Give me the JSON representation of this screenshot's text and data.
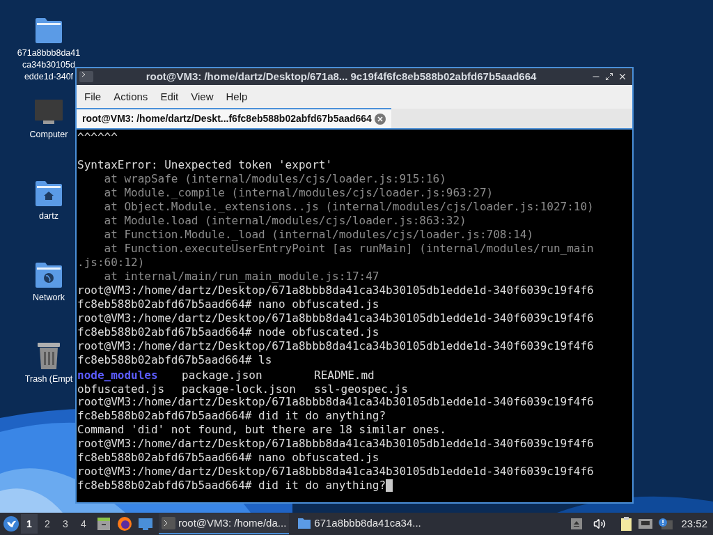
{
  "desktop_icons": [
    {
      "kind": "folder",
      "label_lines": [
        "671a8bbb8da41",
        "ca34b30105d",
        "edde1d-340f"
      ]
    },
    {
      "kind": "computer",
      "label_lines": [
        "Computer"
      ]
    },
    {
      "kind": "home",
      "label_lines": [
        "dartz"
      ]
    },
    {
      "kind": "network",
      "label_lines": [
        "Network"
      ]
    },
    {
      "kind": "trash",
      "label_lines": [
        "Trash (Empt"
      ]
    }
  ],
  "window": {
    "title": "root@VM3: /home/dartz/Desktop/671a8... 9c19f4f6fc8eb588b02abfd67b5aad664",
    "menu": [
      "File",
      "Actions",
      "Edit",
      "View",
      "Help"
    ],
    "tabs": [
      {
        "label": "root@VM3: /home/dartz/Deskt...f6fc8eb588b02abfd67b5aad664",
        "selected": true
      }
    ],
    "lines": [
      {
        "kind": "output",
        "text": "^^^^^^"
      },
      {
        "kind": "blank"
      },
      {
        "kind": "output",
        "text": "SyntaxError: Unexpected token 'export'"
      },
      {
        "kind": "trace",
        "text": "    at wrapSafe (internal/modules/cjs/loader.js:915:16)"
      },
      {
        "kind": "trace",
        "text": "    at Module._compile (internal/modules/cjs/loader.js:963:27)"
      },
      {
        "kind": "trace",
        "text": "    at Object.Module._extensions..js (internal/modules/cjs/loader.js:1027:10)"
      },
      {
        "kind": "trace",
        "text": "    at Module.load (internal/modules/cjs/loader.js:863:32)"
      },
      {
        "kind": "trace",
        "text": "    at Function.Module._load (internal/modules/cjs/loader.js:708:14)"
      },
      {
        "kind": "trace",
        "text": "    at Function.executeUserEntryPoint [as runMain] (internal/modules/run_main"
      },
      {
        "kind": "trace",
        "text": ".js:60:12)"
      },
      {
        "kind": "trace",
        "text": "    at internal/main/run_main_module.js:17:47"
      },
      {
        "kind": "output",
        "text": "root@VM3:/home/dartz/Desktop/671a8bbb8da41ca34b30105db1edde1d-340f6039c19f4f6"
      },
      {
        "kind": "output",
        "text": "fc8eb588b02abfd67b5aad664# nano obfuscated.js"
      },
      {
        "kind": "output",
        "text": "root@VM3:/home/dartz/Desktop/671a8bbb8da41ca34b30105db1edde1d-340f6039c19f4f6"
      },
      {
        "kind": "output",
        "text": "fc8eb588b02abfd67b5aad664# node obfuscated.js"
      },
      {
        "kind": "output",
        "text": "root@VM3:/home/dartz/Desktop/671a8bbb8da41ca34b30105db1edde1d-340f6039c19f4f6"
      },
      {
        "kind": "output",
        "text": "fc8eb588b02abfd67b5aad664# ls"
      },
      {
        "kind": "listing",
        "entries": [
          {
            "text": "node_modules",
            "directory": true
          },
          {
            "text": "package.json",
            "directory": false
          },
          {
            "text": "README.md",
            "directory": false
          }
        ]
      },
      {
        "kind": "listing",
        "entries": [
          {
            "text": "obfuscated.js",
            "directory": false
          },
          {
            "text": "package-lock.json",
            "directory": false
          },
          {
            "text": "ssl-geospec.js",
            "directory": false
          }
        ]
      },
      {
        "kind": "output",
        "text": "root@VM3:/home/dartz/Desktop/671a8bbb8da41ca34b30105db1edde1d-340f6039c19f4f6"
      },
      {
        "kind": "output",
        "text": "fc8eb588b02abfd67b5aad664# did it do anything?"
      },
      {
        "kind": "output",
        "text": "Command 'did' not found, but there are 18 similar ones."
      },
      {
        "kind": "output",
        "text": "root@VM3:/home/dartz/Desktop/671a8bbb8da41ca34b30105db1edde1d-340f6039c19f4f6"
      },
      {
        "kind": "output",
        "text": "fc8eb588b02abfd67b5aad664# nano obfuscated.js"
      },
      {
        "kind": "output",
        "text": "root@VM3:/home/dartz/Desktop/671a8bbb8da41ca34b30105db1edde1d-340f6039c19f4f6"
      },
      {
        "kind": "input",
        "text": "fc8eb588b02abfd67b5aad664# did it do anything?"
      }
    ]
  },
  "taskbar": {
    "workspaces": [
      {
        "label": "1",
        "selected": true
      },
      {
        "label": "2",
        "selected": false
      },
      {
        "label": "3",
        "selected": false
      },
      {
        "label": "4",
        "selected": false
      }
    ],
    "tasks": [
      {
        "kind": "terminal",
        "label": "root@VM3: /home/da...",
        "selected": true
      },
      {
        "kind": "folder",
        "label": "671a8bbb8da41ca34...",
        "selected": false
      }
    ],
    "clock": "23:52"
  }
}
